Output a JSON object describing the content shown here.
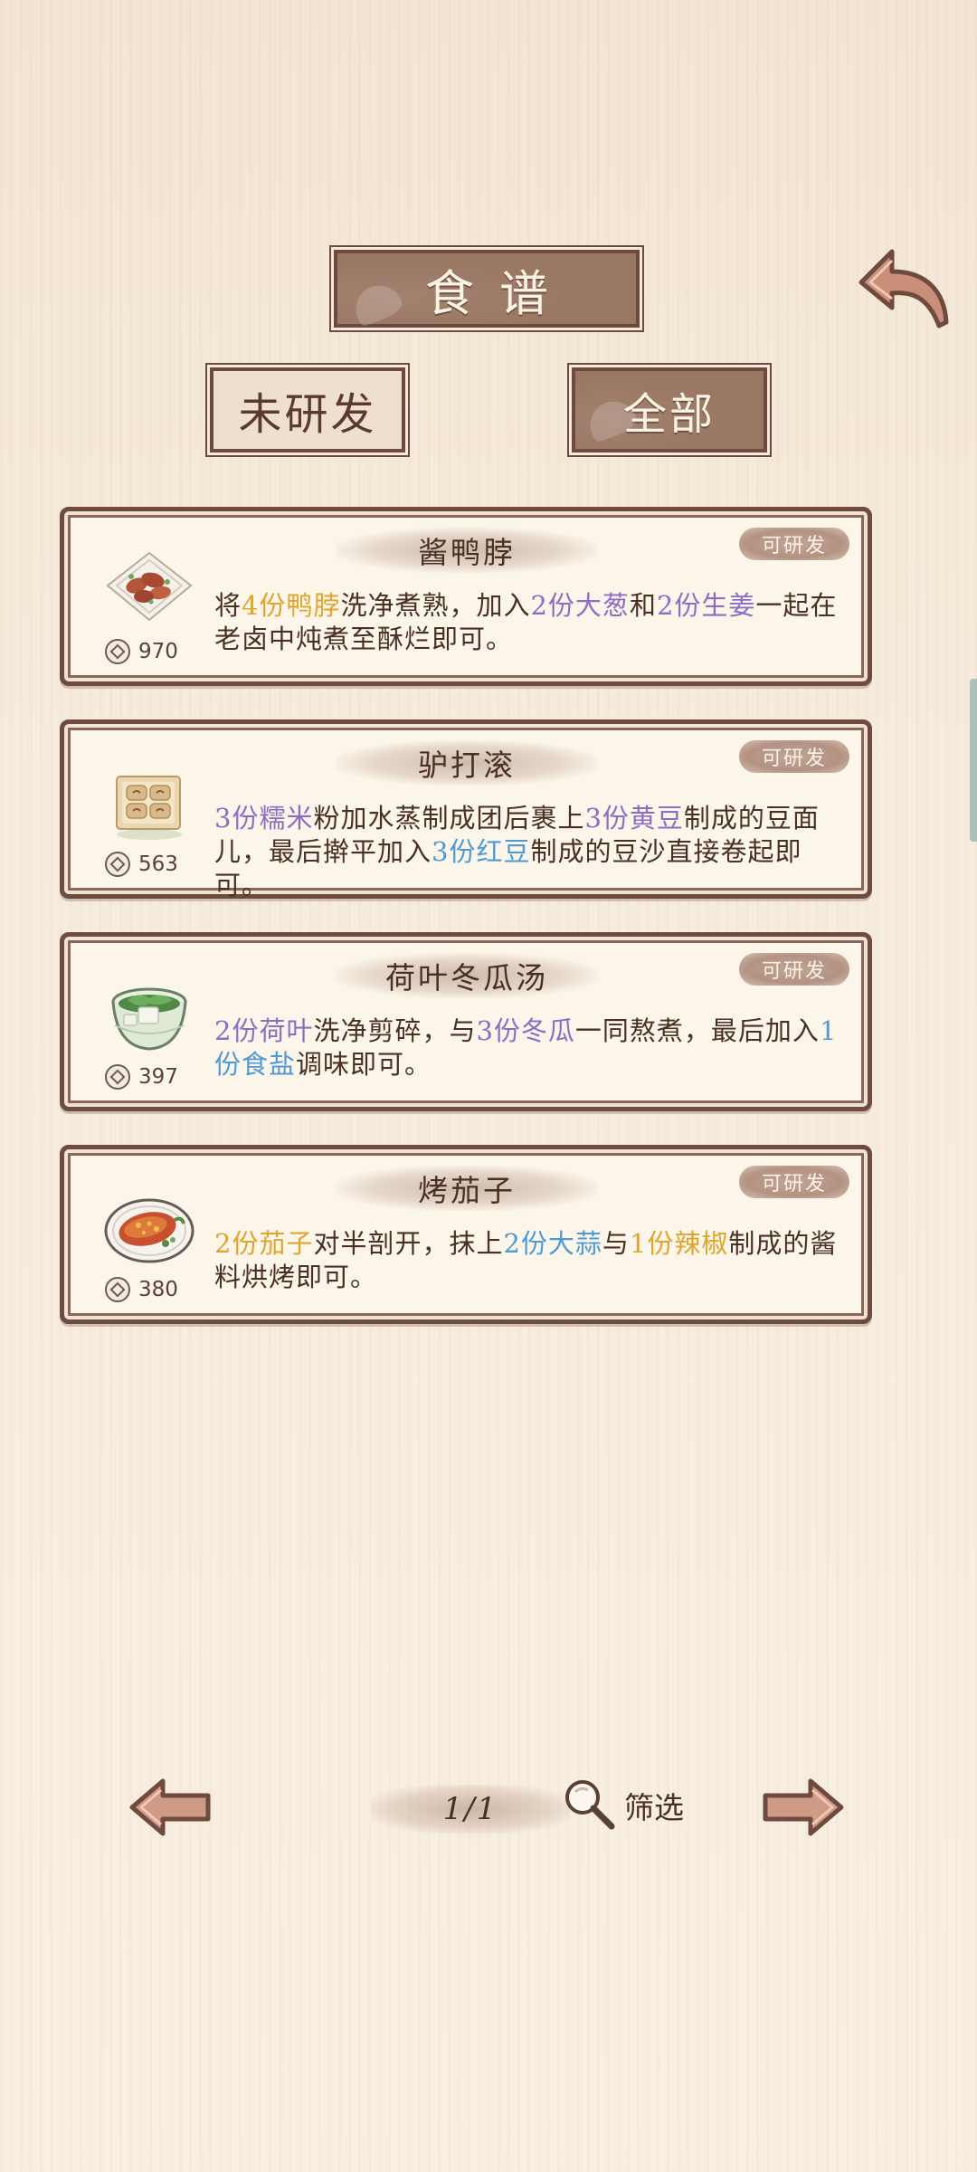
{
  "header": {
    "title": "食谱",
    "back_icon": "back-arrow-icon"
  },
  "tabs": [
    {
      "label": "未研发",
      "selected": false
    },
    {
      "label": "全部",
      "selected": true
    }
  ],
  "recipes": [
    {
      "name": "酱鸭脖",
      "badge": "可研发",
      "cost": "970",
      "icon": "duck-neck-dish-icon",
      "desc": [
        {
          "t": "将",
          "c": ""
        },
        {
          "t": "4份鸭脖",
          "c": "yellow"
        },
        {
          "t": "洗净煮熟，加入",
          "c": ""
        },
        {
          "t": "2份大葱",
          "c": "purple"
        },
        {
          "t": "和",
          "c": ""
        },
        {
          "t": "2份生姜",
          "c": "purple"
        },
        {
          "t": "一起在老卤中炖煮至酥烂即可。",
          "c": ""
        }
      ]
    },
    {
      "name": "驴打滚",
      "badge": "可研发",
      "cost": "563",
      "icon": "donkey-roll-dish-icon",
      "desc": [
        {
          "t": "3份糯米",
          "c": "purple"
        },
        {
          "t": "粉加水蒸制成团后裹上",
          "c": ""
        },
        {
          "t": "3份黄豆",
          "c": "purple"
        },
        {
          "t": "制成的豆面儿，最后擀平加入",
          "c": ""
        },
        {
          "t": "3份红豆",
          "c": "blue"
        },
        {
          "t": "制成的豆沙直接卷起即可。",
          "c": ""
        }
      ]
    },
    {
      "name": "荷叶冬瓜汤",
      "badge": "可研发",
      "cost": "397",
      "icon": "winter-melon-soup-icon",
      "desc": [
        {
          "t": "2份荷叶",
          "c": "purple"
        },
        {
          "t": "洗净剪碎，与",
          "c": ""
        },
        {
          "t": "3份冬瓜",
          "c": "purple"
        },
        {
          "t": "一同熬煮，最后加入",
          "c": ""
        },
        {
          "t": "1份食盐",
          "c": "blue"
        },
        {
          "t": "调味即可。",
          "c": ""
        }
      ]
    },
    {
      "name": "烤茄子",
      "badge": "可研发",
      "cost": "380",
      "icon": "roast-eggplant-dish-icon",
      "desc": [
        {
          "t": "2份茄子",
          "c": "yellow"
        },
        {
          "t": "对半剖开，抹上",
          "c": ""
        },
        {
          "t": "2份大蒜",
          "c": "blue"
        },
        {
          "t": "与",
          "c": ""
        },
        {
          "t": "1份辣椒",
          "c": "yellow"
        },
        {
          "t": "制成的酱料烘烤即可。",
          "c": ""
        }
      ]
    }
  ],
  "footer": {
    "page": "1/1",
    "filter_label": "筛选",
    "prev_icon": "left-arrow-icon",
    "next_icon": "right-arrow-icon",
    "filter_icon": "magnifier-icon"
  },
  "colors": {
    "frame": "#6f4a3f",
    "highlight_yellow": "#e0a52a",
    "highlight_purple": "#8d6dc4",
    "highlight_blue": "#4f9ad6"
  }
}
